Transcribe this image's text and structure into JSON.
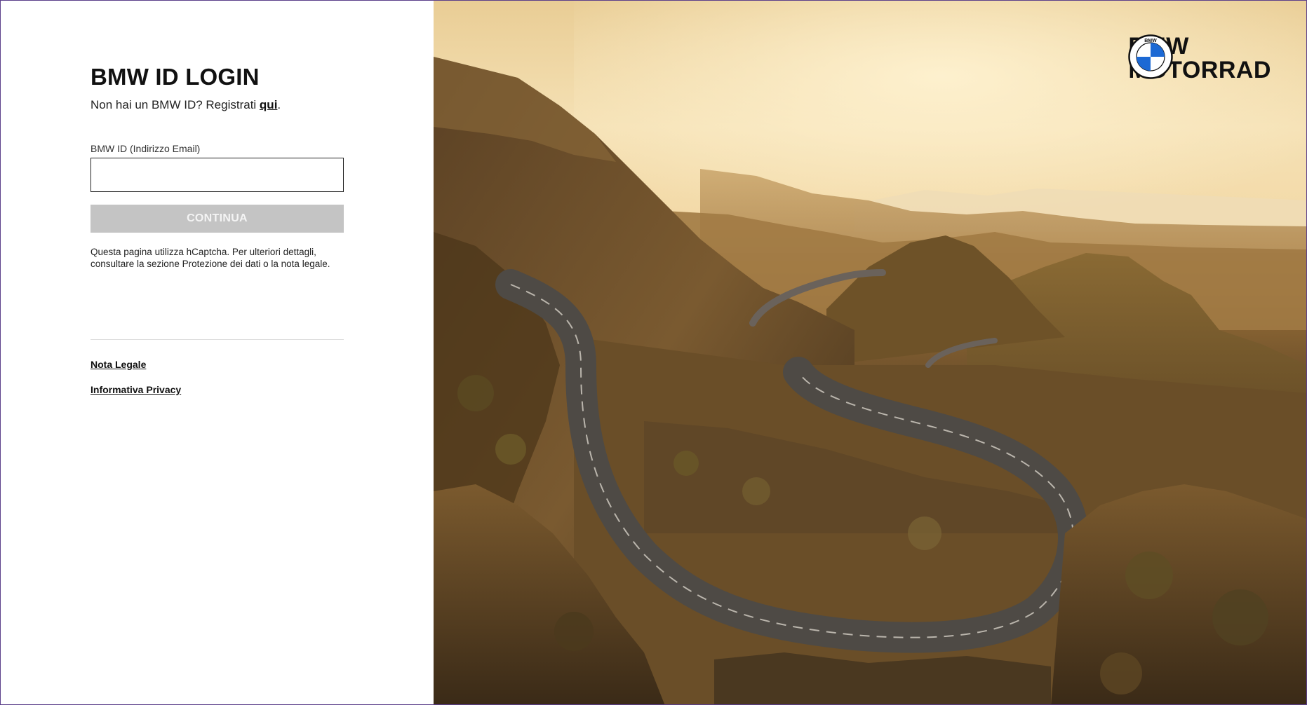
{
  "login": {
    "title": "BMW ID LOGIN",
    "register_prefix": "Non hai un BMW ID? Registrati ",
    "register_link": "qui",
    "register_suffix": ".",
    "email_label": "BMW ID (Indirizzo Email)",
    "email_value": "",
    "continue_label": "CONTINUA",
    "captcha_note": "Questa pagina utilizza hCaptcha. Per ulteriori dettagli, consultare la sezione Protezione dei dati o la nota legale."
  },
  "footer": {
    "legal_link": "Nota Legale",
    "privacy_link": "Informativa Privacy"
  },
  "brand": {
    "line1": "BMW",
    "line2": "MOTORRAD",
    "logo_icon": "bmw-roundel-icon",
    "logo_letters": "BMW",
    "colors": {
      "blue": "#1c69d4",
      "black": "#111111",
      "white": "#ffffff"
    }
  },
  "hero": {
    "image": "winding-mountain-road-photo",
    "colors": {
      "sky": "#f3dcac",
      "hills": "#6b4a26",
      "road": "#4a4642"
    }
  },
  "colors": {
    "button_disabled_bg": "#c4c4c4",
    "button_disabled_text": "#f4f4f4",
    "text": "#111111"
  }
}
